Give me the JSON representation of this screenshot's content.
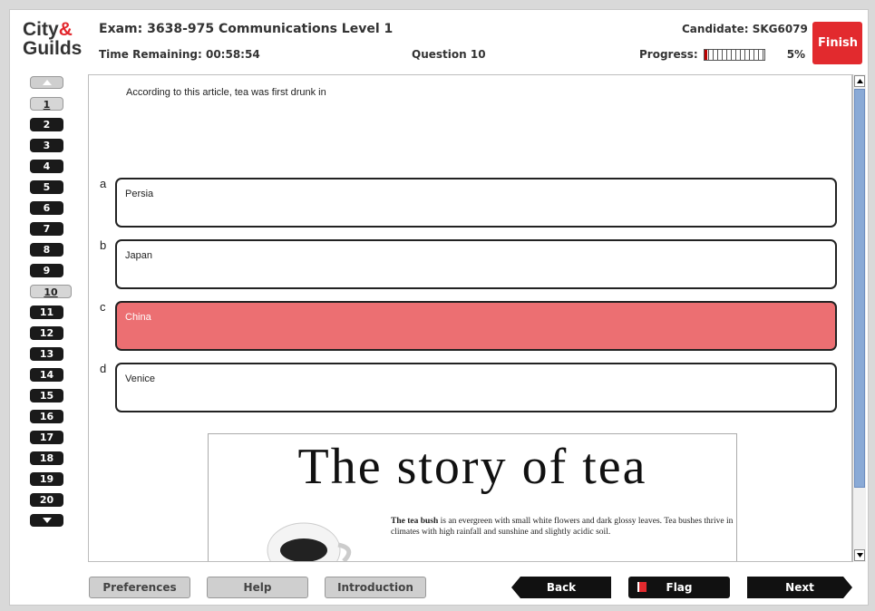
{
  "logo": {
    "line1": "City",
    "amp": "&",
    "line2": "Guilds"
  },
  "header": {
    "exam_title": "Exam: 3638-975 Communications Level 1",
    "time_remaining": "Time Remaining: 00:58:54",
    "question_label": "Question 10",
    "candidate": "Candidate: SKG6079",
    "progress_label": "Progress:",
    "progress_percent": "5%",
    "progress_value": 0.05,
    "finish_label": "Finish"
  },
  "nav": {
    "questions": [
      "1",
      "2",
      "3",
      "4",
      "5",
      "6",
      "7",
      "8",
      "9",
      "10",
      "11",
      "12",
      "13",
      "14",
      "15",
      "16",
      "17",
      "18",
      "19",
      "20"
    ],
    "answered_light": [
      "1"
    ],
    "current": "10"
  },
  "question": {
    "text": "According to this article, tea was first drunk in",
    "options": [
      {
        "letter": "a",
        "label": "Persia",
        "selected": false
      },
      {
        "letter": "b",
        "label": "Japan",
        "selected": false
      },
      {
        "letter": "c",
        "label": "China",
        "selected": true
      },
      {
        "letter": "d",
        "label": "Venice",
        "selected": false
      }
    ]
  },
  "article": {
    "title": "The story of tea",
    "bold_lead": "The tea bush",
    "body": " is an evergreen with small white flowers and dark glossy leaves. Tea bushes thrive in climates with high rainfall and sunshine and slightly acidic soil."
  },
  "footer": {
    "preferences": "Preferences",
    "help": "Help",
    "introduction": "Introduction",
    "back": "Back",
    "flag": "Flag",
    "next": "Next"
  },
  "colors": {
    "brand_red": "#e22a2e",
    "selected_option": "#ec6f72",
    "scroll_thumb": "#8aaad6"
  }
}
